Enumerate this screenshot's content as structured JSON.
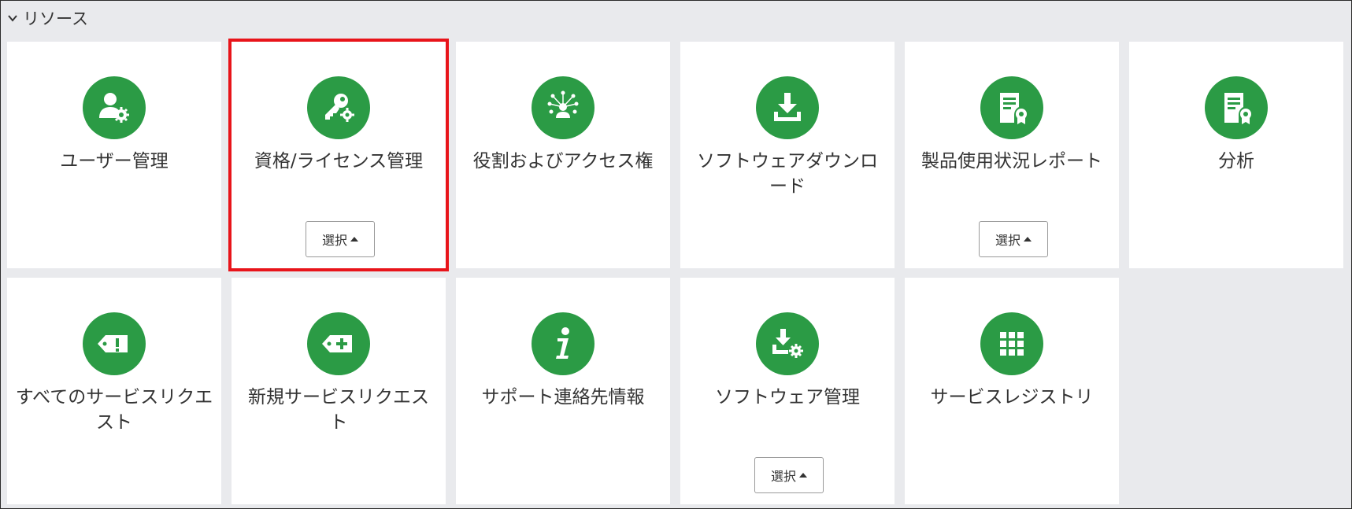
{
  "section": {
    "title": "リソース",
    "icon": "chevron-down-icon"
  },
  "colors": {
    "accent_green": "#2b9b45",
    "highlight_red": "#e8141a",
    "background": "#e9eaed"
  },
  "tiles": [
    {
      "label": "ユーザー管理",
      "icon": "user-gear-icon",
      "has_select": false,
      "highlighted": false
    },
    {
      "label": "資格/ライセンス管理",
      "icon": "key-gear-icon",
      "has_select": true,
      "select_label": "選択",
      "highlighted": true
    },
    {
      "label": "役割およびアクセス権",
      "icon": "user-network-icon",
      "has_select": false,
      "highlighted": false
    },
    {
      "label": "ソフトウェアダウンロード",
      "icon": "download-icon",
      "has_select": false,
      "highlighted": false
    },
    {
      "label": "製品使用状況レポート",
      "icon": "certificate-report-icon",
      "has_select": true,
      "select_label": "選択",
      "highlighted": false
    },
    {
      "label": "分析",
      "icon": "certificate-analysis-icon",
      "has_select": false,
      "highlighted": false
    },
    {
      "label": "すべてのサービスリクエスト",
      "icon": "tag-alert-icon",
      "has_select": false,
      "highlighted": false
    },
    {
      "label": "新規サービスリクエスト",
      "icon": "tag-plus-icon",
      "has_select": false,
      "highlighted": false
    },
    {
      "label": "サポート連絡先情報",
      "icon": "info-icon",
      "has_select": false,
      "highlighted": false
    },
    {
      "label": "ソフトウェア管理",
      "icon": "download-gear-icon",
      "has_select": true,
      "select_label": "選択",
      "highlighted": false
    },
    {
      "label": "サービスレジストリ",
      "icon": "grid-icon",
      "has_select": false,
      "highlighted": false
    }
  ]
}
